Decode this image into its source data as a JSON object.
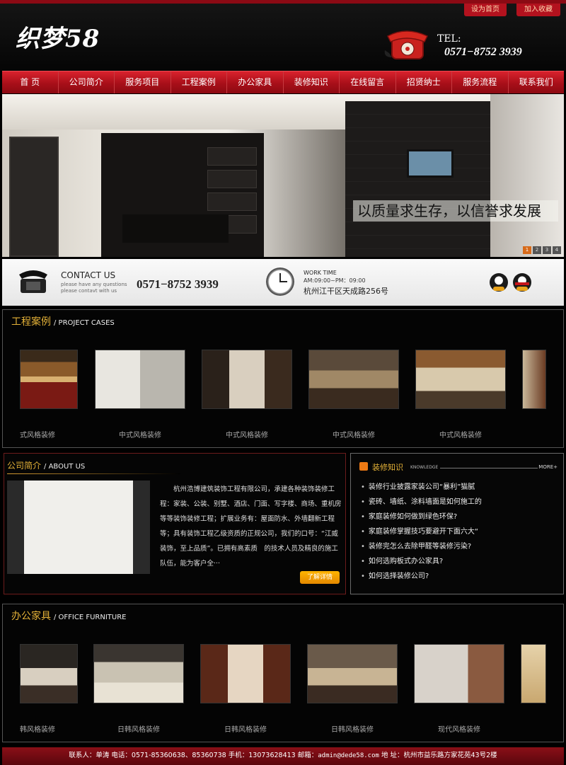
{
  "header": {
    "top_links": [
      "设为首页",
      "加入收藏"
    ],
    "logo": "织梦58",
    "tel_label": "TEL:",
    "tel_number": "0571−8752 3939"
  },
  "nav": [
    "首 页",
    "公司简介",
    "服务项目",
    "工程案例",
    "办公家具",
    "装修知识",
    "在线留言",
    "招贤纳士",
    "服务流程",
    "联系我们"
  ],
  "banner": {
    "slogan": "以质量求生存，以信誉求发展",
    "pages": [
      "1",
      "2",
      "3",
      "4"
    ],
    "active_page": "1"
  },
  "contact": {
    "title": "CONTACT US",
    "subtitle": "please have any questions please contavt with us",
    "phone": "0571−8752 3939",
    "work_time_label": "WORK TIME",
    "work_hours": "AM:09:00~PM：09:00",
    "address": "杭州江干区天成路256号"
  },
  "cases": {
    "title": "工程案例",
    "title_en": "/ PROJECT CASES",
    "items": [
      "式风格装修",
      "中式风格装修",
      "中式风格装修",
      "中式风格装修",
      "中式风格装修"
    ]
  },
  "about": {
    "title": "公司简介",
    "title_en": "/ ABOUT US",
    "text": "杭州浩博建筑装饰工程有限公司，承建各种装饰装修工程：家装、公装、别墅、酒店、门面、写字楼、商场、重机房等等装饰装修工程；扩展业务有：屋面防水、外墙翻新工程等；具有装饰工程乙级资质的正规公司，我们的口号：“江威装饰，至上品质”。已拥有高素质　的技术人员及精良的施工队伍，能为客户全···",
    "more_button": "了解详情"
  },
  "knowledge": {
    "title": "装修知识",
    "title_en": "KNOWLEDGE",
    "more": "MORE+",
    "items": [
      "装修行业披露家装公司“暴利”猫腻",
      "瓷砖、墙纸、涂料墙面是如何施工的",
      "家庭装修如何做到绿色环保?",
      "家庭装修掌握技巧要避开下面六大“",
      "装修完怎么去除甲醛等装修污染?",
      "如何选购板式办公家具?",
      "如何选择装修公司?"
    ]
  },
  "furniture": {
    "title": "办公家具",
    "title_en": "/ OFFICE FURNITURE",
    "items": [
      "韩风格装修",
      "日韩风格装修",
      "日韩风格装修",
      "日韩风格装修",
      "现代风格装修"
    ]
  },
  "footer": {
    "contact": "联系人：单涛 电话：0571-85360638、85360738 手机：13073628413 邮箱：",
    "email": "admin@dede58.com",
    "address": " 地 址：杭州市益乐路方家花苑43号2楼"
  },
  "colors": {
    "accent": "#b3121e",
    "gold": "#e5b238",
    "nav_red": "#d9222d"
  }
}
